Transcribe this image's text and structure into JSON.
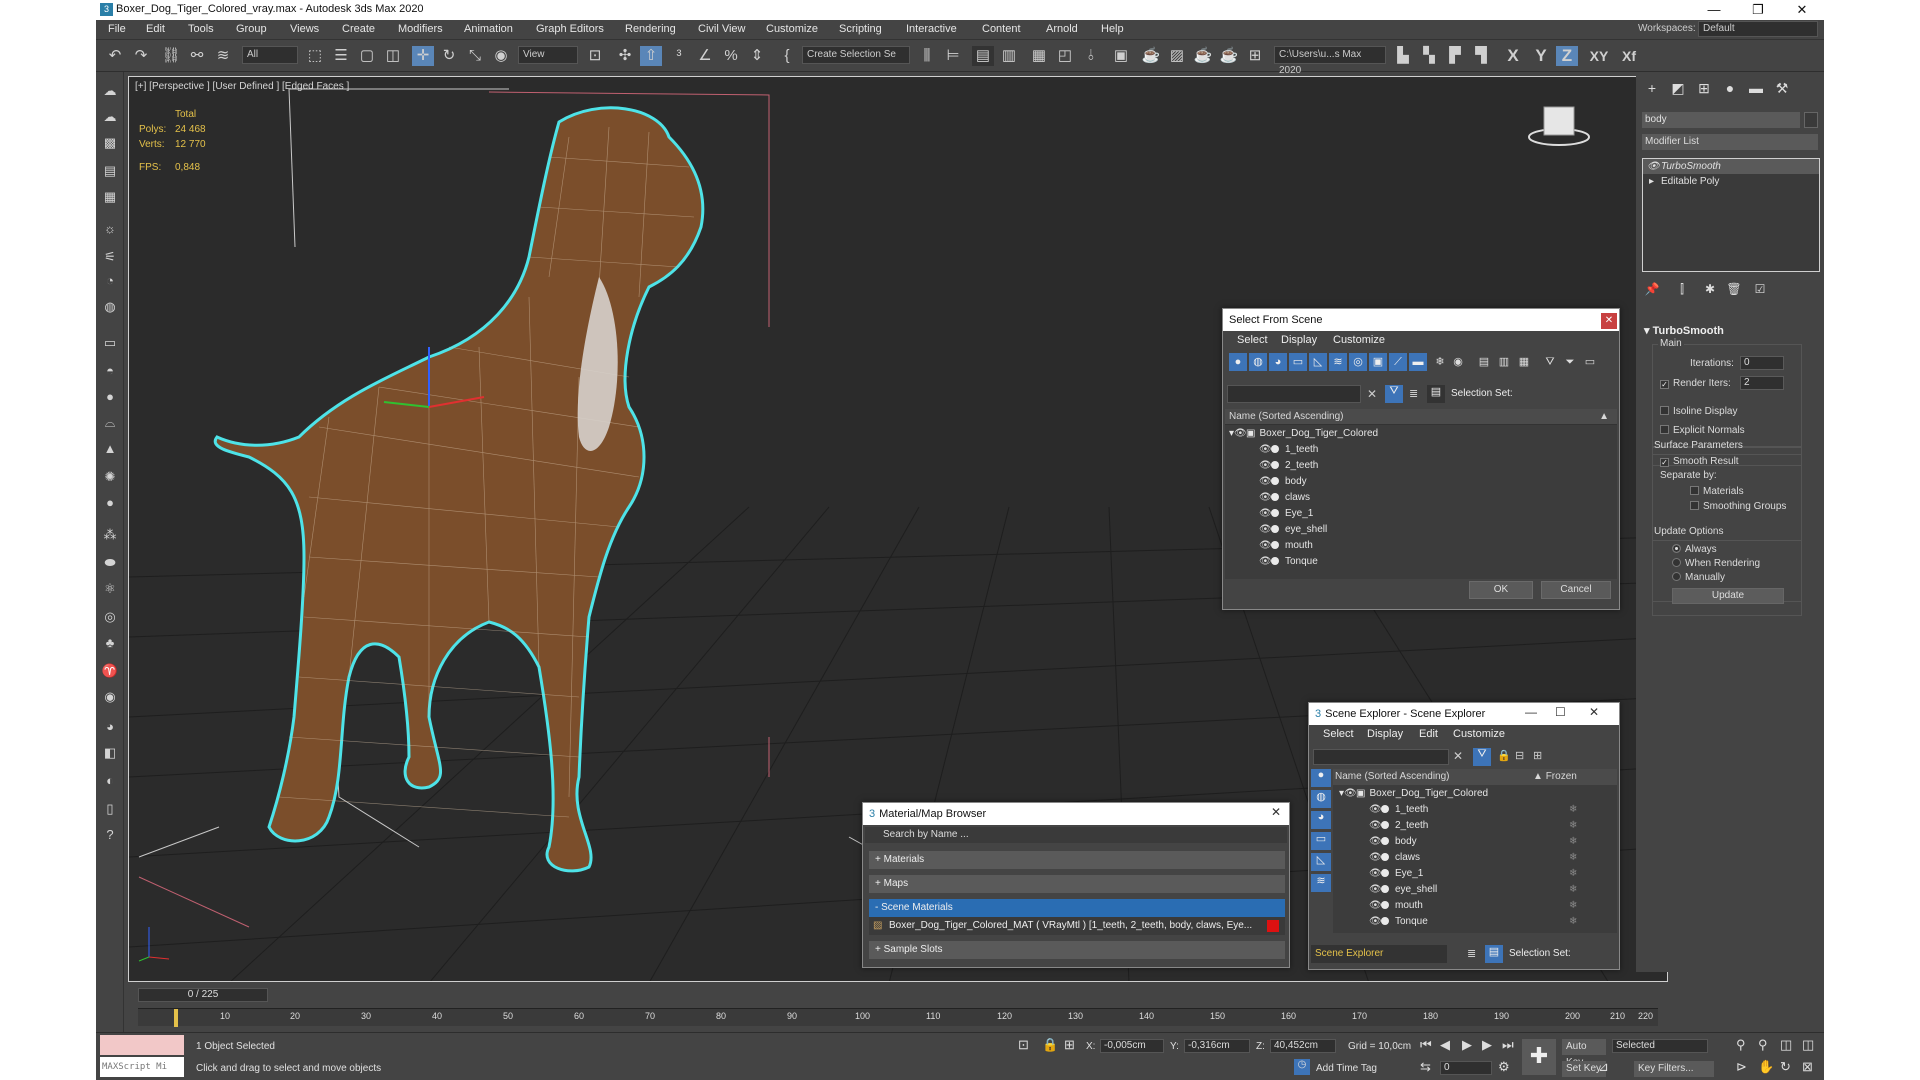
{
  "window": {
    "title": "Boxer_Dog_Tiger_Colored_vray.max - Autodesk 3ds Max 2020",
    "minimize": "—",
    "maximize": "❐",
    "close": "✕",
    "workspace_label": "Workspaces:",
    "workspace_value": "Default"
  },
  "menu": [
    "File",
    "Edit",
    "Tools",
    "Group",
    "Views",
    "Create",
    "Modifiers",
    "Animation",
    "Graph Editors",
    "Rendering",
    "Civil View",
    "Customize",
    "Scripting",
    "Interactive",
    "Content",
    "Arnold",
    "Help"
  ],
  "toolbar": {
    "filter_value": "All",
    "ref_coord": "View",
    "selection_set": "Create Selection Se",
    "project_path": "C:\\Users\\u...s Max 2020",
    "axis_x": "X",
    "axis_y": "Y",
    "axis_z": "Z",
    "axis_xy": "XY",
    "axis_xyp": "Xf"
  },
  "viewport": {
    "label": "[+] [Perspective ] [User Defined ] [Edged Faces ]",
    "stats_header": "Total",
    "polys_label": "Polys:",
    "polys_value": "24 468",
    "verts_label": "Verts:",
    "verts_value": "12 770",
    "fps_label": "FPS:",
    "fps_value": "0,848"
  },
  "command_panel": {
    "object_name": "body",
    "modifier_list": "Modifier List",
    "stack": [
      "TurboSmooth",
      "Editable Poly"
    ],
    "rollout_title": "TurboSmooth",
    "main_label": "Main",
    "iterations_label": "Iterations:",
    "iterations_value": "0",
    "render_iters_label": "Render Iters:",
    "render_iters_value": "2",
    "isoline_label": "Isoline Display",
    "explicit_normals_label": "Explicit Normals",
    "surface_params_label": "Surface Parameters",
    "smooth_result_label": "Smooth Result",
    "separate_by_label": "Separate by:",
    "materials_label": "Materials",
    "smoothing_groups_label": "Smoothing Groups",
    "update_options_label": "Update Options",
    "always_label": "Always",
    "when_rendering_label": "When Rendering",
    "manually_label": "Manually",
    "update_button": "Update"
  },
  "select_from_scene": {
    "title": "Select From Scene",
    "menu": [
      "Select",
      "Display",
      "Customize"
    ],
    "selection_set_label": "Selection Set:",
    "column_header": "Name (Sorted Ascending)",
    "root": "Boxer_Dog_Tiger_Colored",
    "items": [
      "1_teeth",
      "2_teeth",
      "body",
      "claws",
      "Eye_1",
      "eye_shell",
      "mouth",
      "Tonque"
    ],
    "ok": "OK",
    "cancel": "Cancel"
  },
  "scene_explorer": {
    "title": "Scene Explorer - Scene Explorer",
    "menu": [
      "Select",
      "Display",
      "Edit",
      "Customize"
    ],
    "column_header": "Name (Sorted Ascending)",
    "frozen_header": "Frozen",
    "root": "Boxer_Dog_Tiger_Colored",
    "items": [
      "1_teeth",
      "2_teeth",
      "body",
      "claws",
      "Eye_1",
      "eye_shell",
      "mouth",
      "Tonque"
    ],
    "explorer_name": "Scene Explorer",
    "selection_set_label": "Selection Set:"
  },
  "material_browser": {
    "title": "Material/Map Browser",
    "search_placeholder": "Search by Name ...",
    "materials": "+ Materials",
    "maps": "+ Maps",
    "scene_materials": "- Scene Materials",
    "material_entry": "Boxer_Dog_Tiger_Colored_MAT ( VRayMtl ) [1_teeth, 2_teeth, body, claws, Eye...",
    "sample_slots": "+ Sample Slots"
  },
  "timeline": {
    "slider": "0 / 225",
    "ticks": [
      "10",
      "20",
      "30",
      "40",
      "50",
      "60",
      "70",
      "80",
      "90",
      "100",
      "110",
      "120",
      "130",
      "140",
      "150",
      "160",
      "170",
      "180",
      "190",
      "200",
      "210",
      "220"
    ]
  },
  "status": {
    "maxscript": "MAXScript Mi",
    "selected": "1 Object Selected",
    "prompt": "Click and drag to select and move objects",
    "x_label": "X:",
    "x_value": "-0,005cm",
    "y_label": "Y:",
    "y_value": "-0,316cm",
    "z_label": "Z:",
    "z_value": "40,452cm",
    "grid": "Grid = 10,0cm",
    "add_time_tag": "Add Time Tag",
    "auto_key": "Auto Key",
    "set_key": "Set Key",
    "selected_dropdown": "Selected",
    "key_filters": "Key Filters...",
    "frame_value": "0"
  }
}
